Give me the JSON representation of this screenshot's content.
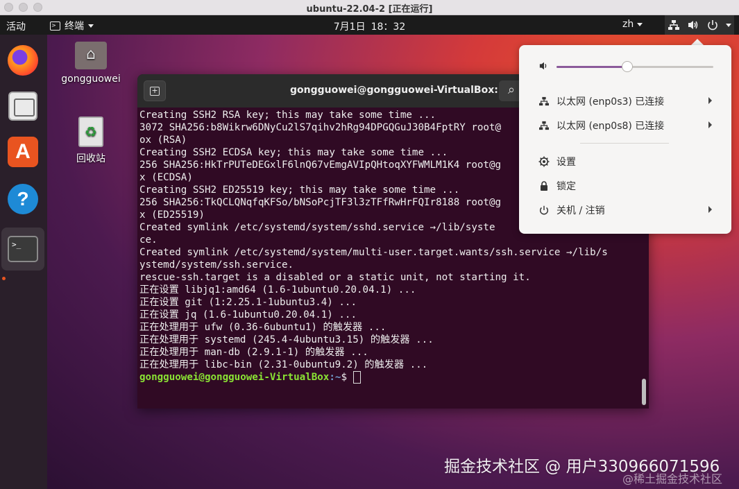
{
  "host_window": {
    "title": "ubuntu-22.04-2 [正在运行]"
  },
  "panel": {
    "activities": "活动",
    "app_name": "终端",
    "date": "7月1日",
    "time": "18：32",
    "language": "zh"
  },
  "desktop": {
    "icons": [
      {
        "label": "gongguowei"
      },
      {
        "label": "回收站"
      }
    ]
  },
  "dock": {
    "items": [
      "firefox-icon",
      "files-icon",
      "software-store-icon",
      "help-icon",
      "terminal-icon"
    ],
    "terminal_glyph": ">_"
  },
  "terminal": {
    "title": "gongguowei@gongguowei-VirtualBox: ~",
    "lines": [
      "Creating SSH2 RSA key; this may take some time ...",
      "3072 SHA256:b8Wikrw6DNyCu2lS7qihv2hRg94DPGQGuJ30B4FptRY root@",
      "ox (RSA)",
      "Creating SSH2 ECDSA key; this may take some time ...",
      "256 SHA256:HkTrPUTeDEGxlF6lnQ67vEmgAVIpQHtoqXYFWMLM1K4 root@g",
      "x (ECDSA)",
      "Creating SSH2 ED25519 key; this may take some time ...",
      "256 SHA256:TkQCLQNqfqKFSo/bNSoPcjTF3l3zTFfRwHrFQIr8188 root@g",
      "x (ED25519)",
      "Created symlink /etc/systemd/system/sshd.service →/lib/syste",
      "ce.",
      "Created symlink /etc/systemd/system/multi-user.target.wants/ssh.service →/lib/s",
      "ystemd/system/ssh.service.",
      "rescue-ssh.target is a disabled or a static unit, not starting it.",
      "正在设置 libjq1:amd64 (1.6-1ubuntu0.20.04.1) ...",
      "正在设置 git (1:2.25.1-1ubuntu3.4) ...",
      "正在设置 jq (1.6-1ubuntu0.20.04.1) ...",
      "正在处理用于 ufw (0.36-6ubuntu1) 的触发器 ...",
      "正在处理用于 systemd (245.4-4ubuntu3.15) 的触发器 ...",
      "正在处理用于 man-db (2.9.1-1) 的触发器 ...",
      "正在处理用于 libc-bin (2.31-0ubuntu9.2) 的触发器 ..."
    ],
    "prompt_user": "gongguowei@gongguowei-VirtualBox",
    "prompt_path": ":~",
    "prompt_symbol": "$"
  },
  "system_menu": {
    "volume_level": 0.45,
    "items": [
      {
        "label": "以太网 (enp0s3) 已连接",
        "icon": "network-wired-icon",
        "submenu": true
      },
      {
        "label": "以太网 (enp0s8) 已连接",
        "icon": "network-wired-icon",
        "submenu": true
      },
      {
        "label": "设置",
        "icon": "gear-icon",
        "submenu": false
      },
      {
        "label": "锁定",
        "icon": "lock-icon",
        "submenu": false
      },
      {
        "label": "关机 / 注销",
        "icon": "power-icon",
        "submenu": true
      }
    ]
  },
  "watermark": {
    "text": "掘金技术社区 @ 用户330966071596",
    "small": "@稀土掘金技术社区"
  }
}
